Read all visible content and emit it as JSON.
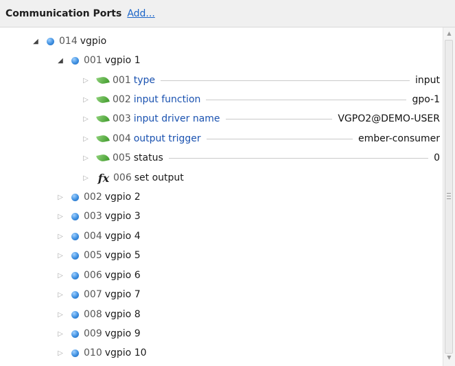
{
  "header": {
    "title": "Communication Ports",
    "add_link": "Add..."
  },
  "tree": {
    "root": {
      "num": "014",
      "name": "vgpio"
    },
    "child": {
      "num": "001",
      "name": "vgpio 1"
    },
    "params": [
      {
        "num": "001",
        "name": "type",
        "value": "input"
      },
      {
        "num": "002",
        "name": "input function",
        "value": "gpo-1"
      },
      {
        "num": "003",
        "name": "input driver name",
        "value": "VGPO2@DEMO-USER"
      },
      {
        "num": "004",
        "name": "output trigger",
        "value": "ember-consumer"
      },
      {
        "num": "005",
        "name": "status",
        "value": "0"
      }
    ],
    "function": {
      "num": "006",
      "name": "set output"
    },
    "siblings": [
      {
        "num": "002",
        "name": "vgpio 2"
      },
      {
        "num": "003",
        "name": "vgpio 3"
      },
      {
        "num": "004",
        "name": "vgpio 4"
      },
      {
        "num": "005",
        "name": "vgpio 5"
      },
      {
        "num": "006",
        "name": "vgpio 6"
      },
      {
        "num": "007",
        "name": "vgpio 7"
      },
      {
        "num": "008",
        "name": "vgpio 8"
      },
      {
        "num": "009",
        "name": "vgpio 9"
      },
      {
        "num": "010",
        "name": "vgpio 10"
      }
    ]
  },
  "icons": {
    "expanded": "triangle-expanded-icon",
    "collapsed": "triangle-collapsed-icon",
    "node": "blue-sphere-icon",
    "parameter": "green-leaf-icon",
    "function": "fx-function-icon"
  },
  "colors": {
    "header_bg": "#f0f0f0",
    "link": "#1a64c8",
    "param_name": "#1a52b0",
    "node": "#3e8fe0",
    "leaf": "#4ea336"
  }
}
